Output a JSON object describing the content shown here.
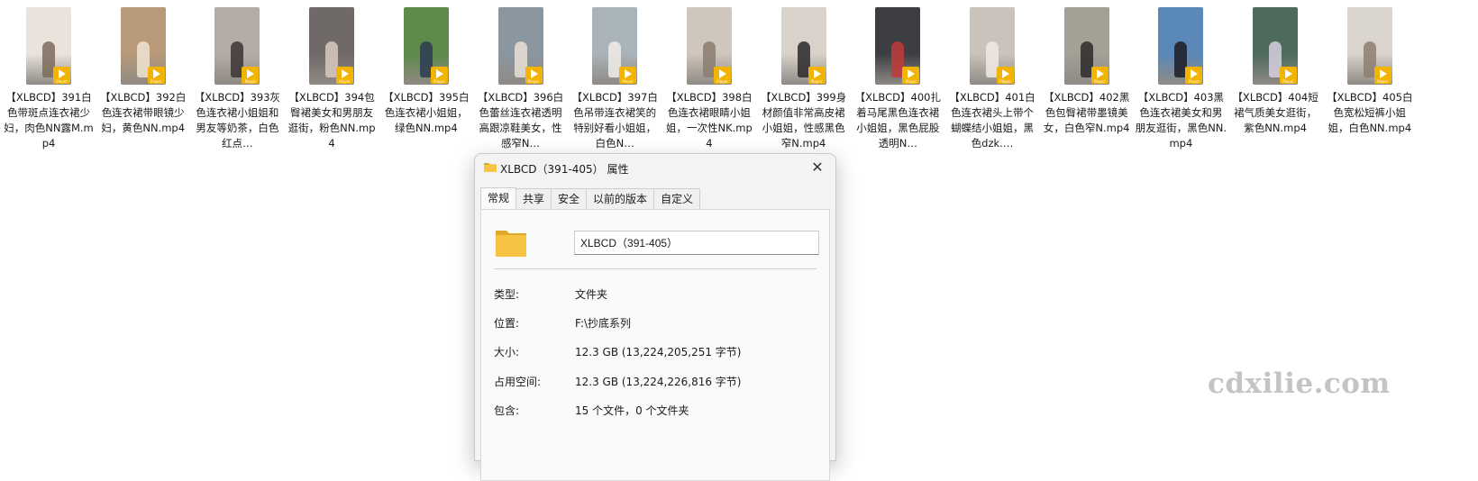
{
  "files": [
    {
      "name": "【XLBCD】391白色带斑点连衣裙少妇，肉色NN露M.mp4",
      "bg": "#e9e3dc",
      "fg": "#7b6b5a"
    },
    {
      "name": "【XLBCD】392白色连衣裙带眼镜少妇，黄色NN.mp4",
      "bg": "#b89a78",
      "fg": "#efe4d2"
    },
    {
      "name": "【XLBCD】393灰色连衣裙小姐姐和男友等奶茶，白色红点…",
      "bg": "#b5aca6",
      "fg": "#3a3432"
    },
    {
      "name": "【XLBCD】394包臀裙美女和男朋友逛街，粉色NN.mp4",
      "bg": "#6f6a68",
      "fg": "#d9c8c0"
    },
    {
      "name": "【XLBCD】395白色连衣裙小姐姐，绿色NN.mp4",
      "bg": "#5e8a4a",
      "fg": "#2d3b52"
    },
    {
      "name": "【XLBCD】396白色蕾丝连衣裙透明高跟凉鞋美女，性感窄N…",
      "bg": "#8a96a0",
      "fg": "#e9e0d6"
    },
    {
      "name": "【XLBCD】397白色吊带连衣裙笑的特别好看小姐姐，白色N…",
      "bg": "#a9b3ba",
      "fg": "#f1ece6"
    },
    {
      "name": "【XLBCD】398白色连衣裙眼睛小姐姐，一次性NK.mp4",
      "bg": "#cfc6bd",
      "fg": "#8b7c70"
    },
    {
      "name": "【XLBCD】399身材颜值非常高皮裙小姐姐，性感黑色窄N.mp4",
      "bg": "#d8d2cb",
      "fg": "#2a2a2a"
    },
    {
      "name": "【XLBCD】400扎着马尾黑色连衣裙小姐姐，黑色屁股透明N…",
      "bg": "#3c3e44",
      "fg": "#c23a3a"
    },
    {
      "name": "【XLBCD】401白色连衣裙头上带个蝴蝶结小姐姐，黑色dzk.…",
      "bg": "#c9c3bb",
      "fg": "#eeeae4"
    },
    {
      "name": "【XLBCD】402黑色包臀裙带墨镜美女，白色窄N.mp4",
      "bg": "#a3a096",
      "fg": "#2c2a2a"
    },
    {
      "name": "【XLBCD】403黑色连衣裙美女和男朋友逛街，黑色NN.mp4",
      "bg": "#5a88b8",
      "fg": "#1d1d22"
    },
    {
      "name": "【XLBCD】404短裙气质美女逛街，紫色NN.mp4",
      "bg": "#4d6a5c",
      "fg": "#d6d0e0"
    },
    {
      "name": "【XLBCD】405白色宽松短裤小姐姐，白色NN.mp4",
      "bg": "#d9d4cd",
      "fg": "#8f7e70"
    }
  ],
  "player_badge_text": "Player",
  "dialog": {
    "title": "XLBCD（391-405） 属性",
    "close_glyph": "✕",
    "tabs": [
      "常规",
      "共享",
      "安全",
      "以前的版本",
      "自定义"
    ],
    "name_value": "XLBCD（391-405）",
    "props": {
      "type_label": "类型:",
      "type_value": "文件夹",
      "location_label": "位置:",
      "location_value": "F:\\抄底系列",
      "size_label": "大小:",
      "size_value": "12.3 GB (13,224,205,251 字节)",
      "disk_label": "占用空间:",
      "disk_value": "12.3 GB (13,224,226,816 字节)",
      "contains_label": "包含:",
      "contains_value": "15 个文件，0 个文件夹"
    }
  },
  "watermark": "cdxilie.com",
  "colors": {
    "folder": "#f6c343",
    "folder_dark": "#e0a92a",
    "badge": "#f2b400"
  }
}
